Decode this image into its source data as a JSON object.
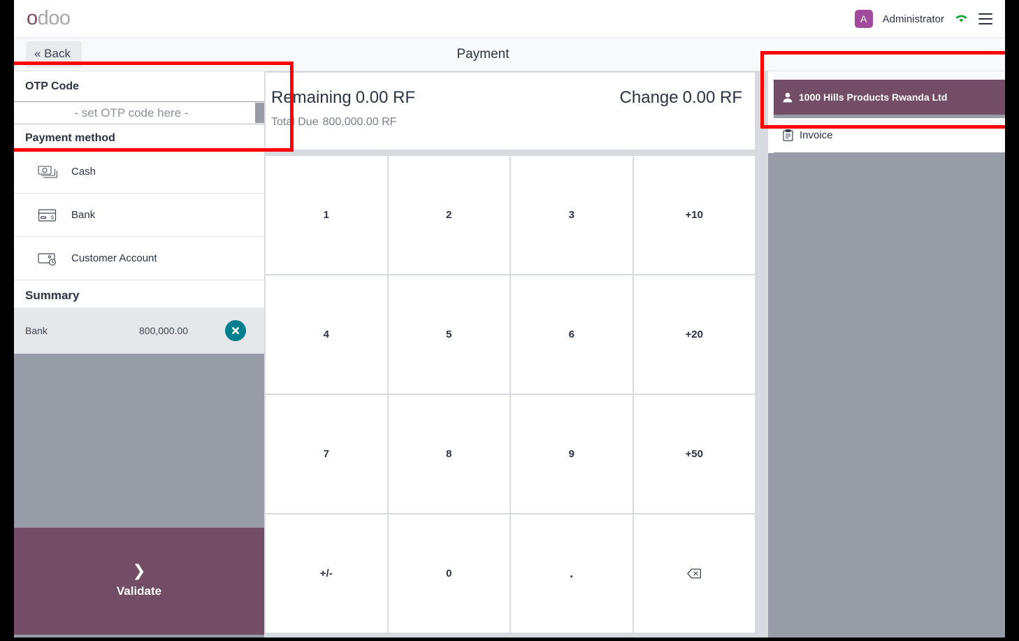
{
  "app": {
    "logo_first": "o",
    "logo_rest": "doo"
  },
  "topbar": {
    "avatar_initial": "A",
    "user_name": "Administrator",
    "wifi_icon": "wifi-icon",
    "menu_icon": "hamburger-menu-icon"
  },
  "subheader": {
    "back_label": "« Back",
    "title": "Payment"
  },
  "left_panel": {
    "otp_section_label": "OTP Code",
    "otp_placeholder": "- set OTP code here -",
    "otp_value": "",
    "payment_method_label": "Payment method",
    "payment_methods": [
      {
        "label": "Cash",
        "icon": "cash-icon"
      },
      {
        "label": "Bank",
        "icon": "credit-card-icon"
      },
      {
        "label": "Customer Account",
        "icon": "wallet-clock-icon"
      }
    ],
    "summary_label": "Summary",
    "summary_rows": [
      {
        "name": "Bank",
        "amount": "800,000.00",
        "clear_icon": "clear-circle-x-icon"
      }
    ],
    "validate_label": "Validate",
    "validate_icon": "chevron-right-icon"
  },
  "center_panel": {
    "remaining_label": "Remaining",
    "remaining_value": "0.00 RF",
    "change_label": "Change",
    "change_value": "0.00 RF",
    "total_due_label": "Total Due",
    "total_due_value": "800,000.00 RF",
    "numpad": [
      "1",
      "2",
      "3",
      "+10",
      "4",
      "5",
      "6",
      "+20",
      "7",
      "8",
      "9",
      "+50",
      "+/-",
      "0",
      ".",
      "backspace-icon"
    ]
  },
  "right_panel": {
    "customer_name": "1000 Hills Products Rwanda Ltd",
    "customer_icon": "user-icon",
    "invoice_label": "Invoice",
    "invoice_icon": "invoice-document-icon"
  },
  "colors": {
    "brand_purple": "#734c66",
    "logo_purple": "#7d4c68",
    "avatar_purple": "#a24b9c",
    "teal_clear": "#00808f",
    "wifi_green": "#00a82d",
    "panel_grey": "#989ca6",
    "annotation_red": "#ff0000",
    "text_dark": "#2b3445"
  }
}
